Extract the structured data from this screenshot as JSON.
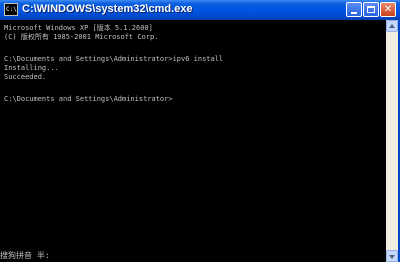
{
  "window": {
    "title": "C:\\WINDOWS\\system32\\cmd.exe",
    "icon": "cmd-icon",
    "icon_glyph": "C:\\"
  },
  "console": {
    "lines": [
      "Microsoft Windows XP [版本 5.1.2600]",
      "(C) 版权所有 1985-2001 Microsoft Corp.",
      "C:\\Documents and Settings\\Administrator>ipv6 install",
      "Installing...",
      "Succeeded.",
      "C:\\Documents and Settings\\Administrator>"
    ]
  },
  "ime": {
    "status": "搜狗拼音 半:"
  },
  "colors": {
    "titlebar": "#0054e3",
    "console_bg": "#000000",
    "console_text": "#c0c0c0",
    "close": "#c8401a"
  }
}
